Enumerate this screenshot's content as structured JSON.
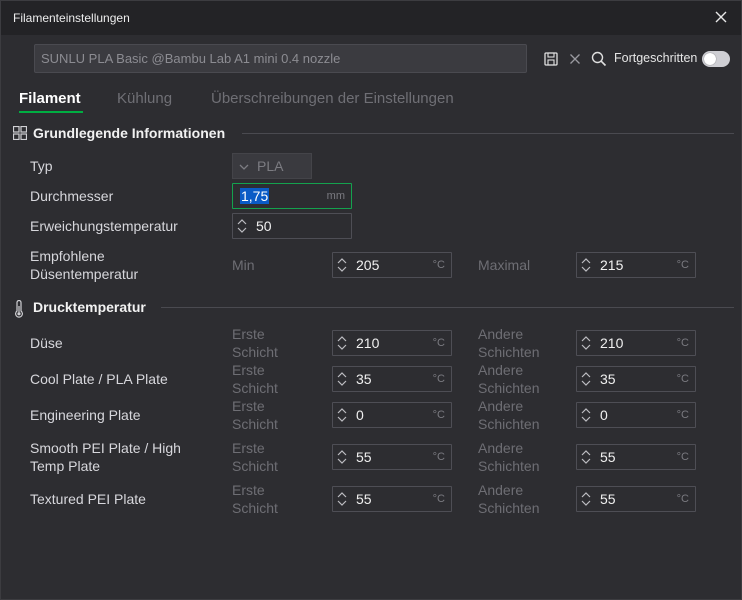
{
  "window": {
    "title": "Filamenteinstellungen"
  },
  "toolbar": {
    "preset": "SUNLU PLA Basic @Bambu Lab A1 mini 0.4 nozzle",
    "advanced_label": "Fortgeschritten",
    "advanced_on": false
  },
  "tabs": [
    {
      "label": "Filament",
      "active": true
    },
    {
      "label": "Kühlung",
      "active": false
    },
    {
      "label": "Überschreibungen der Einstellungen",
      "active": false
    }
  ],
  "basic": {
    "title": "Grundlegende Informationen",
    "type_label": "Typ",
    "type_value": "PLA",
    "diameter_label": "Durchmesser",
    "diameter_value": "1,75",
    "diameter_unit": "mm",
    "softening_label": "Erweichungstemperatur",
    "softening_value": "50",
    "nozzle_temp_label_1": "Empfohlene",
    "nozzle_temp_label_2": "Düsentemperatur",
    "min_label": "Min",
    "min_value": "205",
    "max_label": "Maximal",
    "max_value": "215",
    "unit": "°C"
  },
  "print_temp": {
    "title": "Drucktemperatur",
    "first_1": "Erste",
    "first_2": "Schicht",
    "other_1": "Andere",
    "other_2": "Schichten",
    "unit": "°C",
    "rows": [
      {
        "label_1": "Düse",
        "label_2": "",
        "first": "210",
        "other": "210"
      },
      {
        "label_1": "Cool Plate / PLA Plate",
        "label_2": "",
        "first": "35",
        "other": "35"
      },
      {
        "label_1": "Engineering Plate",
        "label_2": "",
        "first": "0",
        "other": "0"
      },
      {
        "label_1": "Smooth PEI Plate / High",
        "label_2": "Temp Plate",
        "first": "55",
        "other": "55"
      },
      {
        "label_1": "Textured PEI Plate",
        "label_2": "",
        "first": "55",
        "other": "55"
      }
    ]
  },
  "colors": {
    "accent": "#00ae42",
    "focus": "#14a24e",
    "selection": "#0a5bc6"
  }
}
